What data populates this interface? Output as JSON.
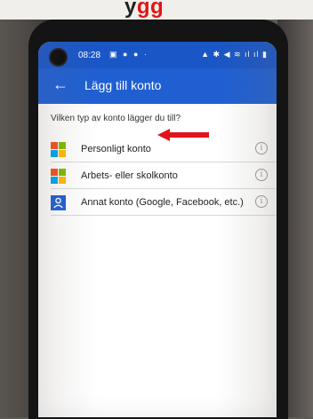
{
  "banner": {
    "prefix": "y",
    "highlight": "gg"
  },
  "status_bar": {
    "time": "08:28",
    "left_icons": "▣ ● ● ·",
    "right_icons": "▲ ✱ ◀ ≋ ıl ıl ▮"
  },
  "app_bar": {
    "back_icon": "←",
    "title": "Lägg till konto"
  },
  "question": "Vilken typ av konto lägger du till?",
  "options": [
    {
      "label": "Personligt konto",
      "icon": "microsoft-logo"
    },
    {
      "label": "Arbets- eller skolkonto",
      "icon": "microsoft-logo"
    },
    {
      "label": "Annat konto (Google, Facebook, etc.)",
      "icon": "person-icon"
    }
  ],
  "info_glyph": "i",
  "colors": {
    "status_bar": "#1a56c6",
    "app_bar": "#1f5fd2",
    "annotation_arrow": "#e0141c"
  }
}
